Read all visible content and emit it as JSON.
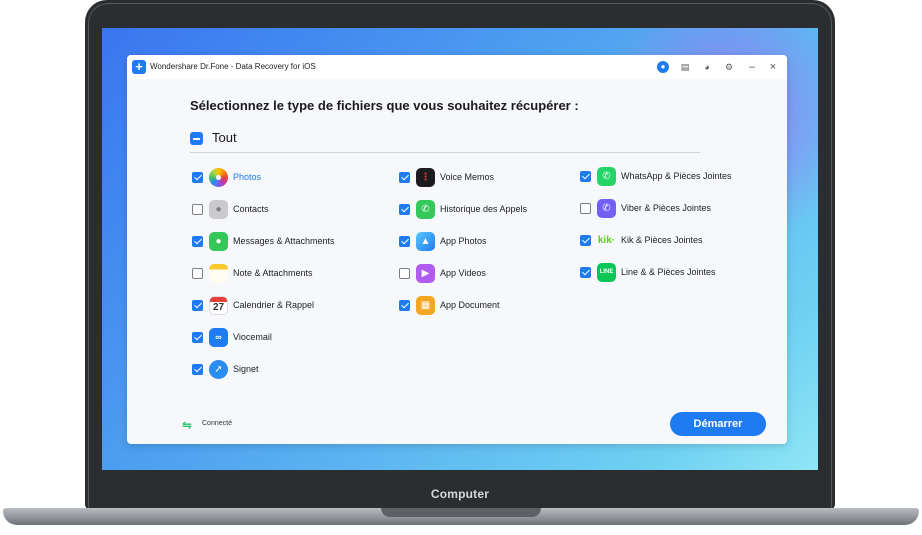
{
  "window": {
    "title": "Wondershare Dr.Fone - Data Recovery for iOS"
  },
  "main": {
    "heading": "Sélectionnez le type de fichiers que vous souhaitez récupérer :",
    "select_all_label": "Tout",
    "categories": [
      {
        "label": "Photos",
        "checked": true,
        "icon": "photos-icon"
      },
      {
        "label": "Contacts",
        "checked": false,
        "icon": "contacts-icon"
      },
      {
        "label": "Messages & Attachments",
        "checked": true,
        "icon": "messages-icon"
      },
      {
        "label": "Note & Attachments",
        "checked": false,
        "icon": "notes-icon"
      },
      {
        "label": "Calendrier & Rappel",
        "checked": true,
        "icon": "calendar-icon"
      },
      {
        "label": "Viocemail",
        "checked": true,
        "icon": "voicemail-icon"
      },
      {
        "label": "Signet",
        "checked": true,
        "icon": "safari-icon"
      },
      {
        "label": "Voice Memos",
        "checked": true,
        "icon": "voice-memos-icon"
      },
      {
        "label": "Historique des Appels",
        "checked": true,
        "icon": "phone-icon"
      },
      {
        "label": "App Photos",
        "checked": true,
        "icon": "app-photos-icon"
      },
      {
        "label": "App Videos",
        "checked": false,
        "icon": "app-videos-icon"
      },
      {
        "label": "App Document",
        "checked": true,
        "icon": "app-document-icon"
      },
      {
        "label": "WhatsApp & Pièces Jointes",
        "checked": true,
        "icon": "whatsapp-icon"
      },
      {
        "label": "Viber & Pièces Jointes",
        "checked": false,
        "icon": "viber-icon"
      },
      {
        "label": "Kik & Pièces Jointes",
        "checked": true,
        "icon": "kik-icon"
      },
      {
        "label": "Line & & Pièces Jointes",
        "checked": true,
        "icon": "line-icon"
      }
    ],
    "calendar_day": "27",
    "kik_text": "kik·",
    "line_text": "LINE"
  },
  "footer": {
    "status_label": "Connecté",
    "start_button": "Démarrer"
  },
  "device": {
    "label": "Computer"
  },
  "colors": {
    "accent": "#1f7bf2",
    "connected": "#2ec06a"
  }
}
